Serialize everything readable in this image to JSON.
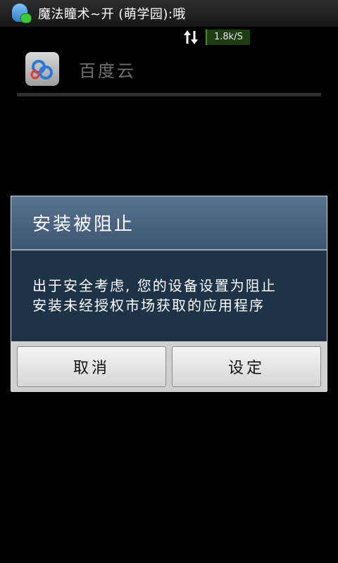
{
  "status_bar": {
    "notification_text": "魔法瞳术~开 (萌学园):哦",
    "net_speed": "1.8k/S"
  },
  "background_app": {
    "name": "百度云"
  },
  "dialog": {
    "title": "安装被阻止",
    "message_line1": "出于安全考虑, 您的设备设置为阻止",
    "message_line2": "安装未经授权市场获取的应用程序",
    "cancel_label": "取消",
    "settings_label": "设定"
  },
  "colors": {
    "dialog_title_bg": "#4c6482",
    "dialog_body_bg": "#1e3248",
    "button_bg": "#e6e6e6"
  },
  "icons": {
    "status": "qq-icon",
    "network": "updown-arrows-icon",
    "app": "baidu-cloud-icon"
  }
}
